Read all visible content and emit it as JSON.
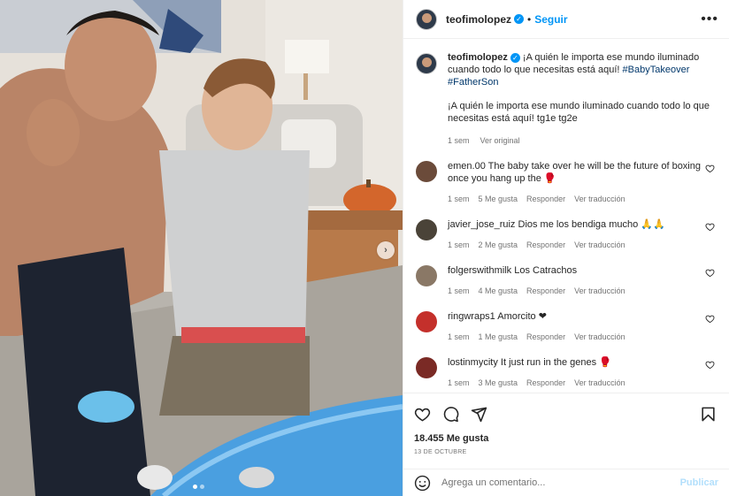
{
  "post": {
    "username": "teofimolopez",
    "follow_label": "Seguir",
    "separator": "•",
    "more_label": "•••",
    "carousel_next": "›"
  },
  "caption": {
    "username": "teofimolopez",
    "text": "¡A quién le importa ese mundo iluminado cuando todo lo que necesitas está aquí!",
    "hashtags": [
      "#BabyTakeover",
      "#FatherSon"
    ],
    "extra": "¡A quién le importa ese mundo iluminado cuando todo lo que necesitas está aquí! tg1e tg2e",
    "time": "1 sem",
    "see_original": "Ver original"
  },
  "comments": [
    {
      "username": "emen.00",
      "text": "The baby take over he will be the future of boxing once you hang up the 🥊",
      "time": "1 sem",
      "likes": "5 Me gusta",
      "reply": "Responder",
      "translate": "Ver traducción",
      "avatar_color": "#6b4b3a"
    },
    {
      "username": "javier_jose_ruiz",
      "text": "Dios me los bendiga mucho 🙏🙏",
      "time": "1 sem",
      "likes": "2 Me gusta",
      "reply": "Responder",
      "translate": "Ver traducción",
      "avatar_color": "#4a4338"
    },
    {
      "username": "folgerswithmilk",
      "text": "Los Catrachos",
      "time": "1 sem",
      "likes": "4 Me gusta",
      "reply": "Responder",
      "translate": "Ver traducción",
      "avatar_color": "#8a7866"
    },
    {
      "username": "ringwraps1",
      "text": "Amorcito ❤",
      "time": "1 sem",
      "likes": "1 Me gusta",
      "reply": "Responder",
      "translate": "Ver traducción",
      "avatar_color": "#c4302b"
    },
    {
      "username": "lostinmycity",
      "text": "It just run in the genes 🥊",
      "time": "1 sem",
      "likes": "3 Me gusta",
      "reply": "Responder",
      "translate": "Ver traducción",
      "avatar_color": "#7a2a25"
    }
  ],
  "actions": {
    "likes": "18.455 Me gusta",
    "date": "13 DE OCTUBRE"
  },
  "add_comment": {
    "placeholder": "Agrega un comentario...",
    "post_label": "Publicar"
  },
  "colors": {
    "accent": "#0095f6",
    "link": "#00376b",
    "muted": "#737373"
  }
}
